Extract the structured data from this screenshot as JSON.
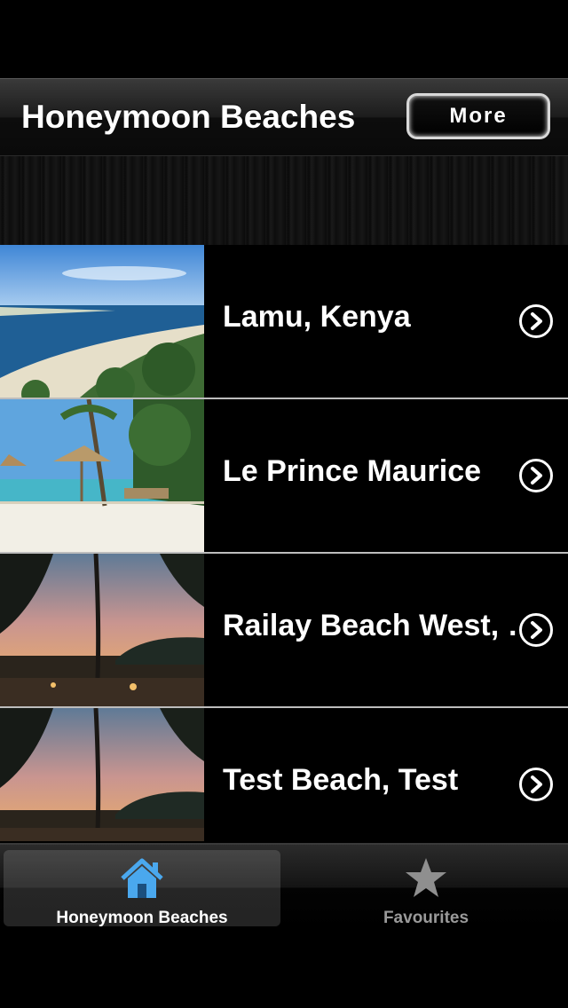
{
  "nav": {
    "title": "Honeymoon Beaches",
    "more_label": "More"
  },
  "beaches": [
    {
      "name": "Lamu, Kenya",
      "thumb_icon": "beach-photo"
    },
    {
      "name": "Le Prince Maurice",
      "thumb_icon": "beach-umbrella-photo"
    },
    {
      "name": "Railay Beach West, Thailand",
      "thumb_icon": "sunset-photo"
    },
    {
      "name": "Test Beach, Test",
      "thumb_icon": "sunset-photo"
    }
  ],
  "tabs": [
    {
      "label": "Honeymoon Beaches",
      "icon": "home-icon",
      "selected": true
    },
    {
      "label": "Favourites",
      "icon": "star-icon",
      "selected": false
    }
  ],
  "colors": {
    "tab_selected": "#ffffff",
    "tab_unselected": "#9a9a9a",
    "home_icon": "#4aa8ee"
  }
}
